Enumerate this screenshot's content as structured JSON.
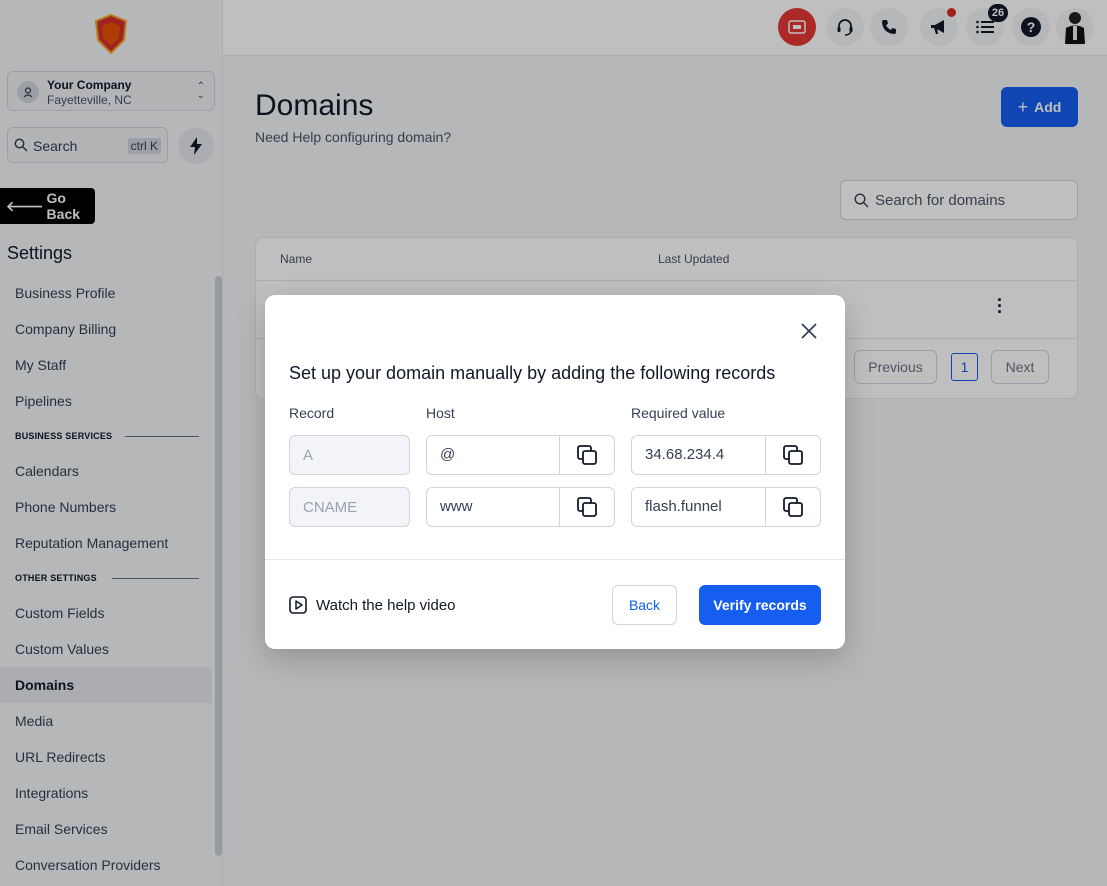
{
  "sidebar": {
    "company_name": "Your Company",
    "company_location": "Fayetteville, NC",
    "search_label": "Search",
    "search_shortcut": "ctrl K",
    "go_back": "Go Back",
    "settings_title": "Settings",
    "items_top": [
      "Business Profile",
      "Company Billing",
      "My Staff",
      "Pipelines"
    ],
    "section_business": "BUSINESS SERVICES",
    "items_business": [
      "Calendars",
      "Phone Numbers",
      "Reputation Management"
    ],
    "section_other": "OTHER SETTINGS",
    "items_other": [
      "Custom Fields",
      "Custom Values",
      "Domains",
      "Media",
      "URL Redirects",
      "Integrations",
      "Email Services",
      "Conversation Providers"
    ],
    "active_item": "Domains"
  },
  "topbar": {
    "tasks_badge": "26"
  },
  "main": {
    "title": "Domains",
    "subtitle": "Need Help configuring domain?",
    "add_label": "Add",
    "search_placeholder": "Search for domains",
    "table": {
      "columns": [
        "Name",
        "Last Updated"
      ],
      "pagination": {
        "previous": "Previous",
        "current": "1",
        "next": "Next"
      }
    }
  },
  "modal": {
    "title": "Set up your domain manually by adding the following records",
    "columns": [
      "Record",
      "Host",
      "Required value"
    ],
    "rows": [
      {
        "record": "A",
        "host": "@",
        "value": "34.68.234.4"
      },
      {
        "record": "CNAME",
        "host": "www",
        "value": "flash.funnel"
      }
    ],
    "help_video": "Watch the help video",
    "back_label": "Back",
    "verify_label": "Verify records"
  },
  "colors": {
    "primary": "#155eef",
    "text": "#101828",
    "muted": "#475467",
    "border": "#d0d5dd"
  }
}
